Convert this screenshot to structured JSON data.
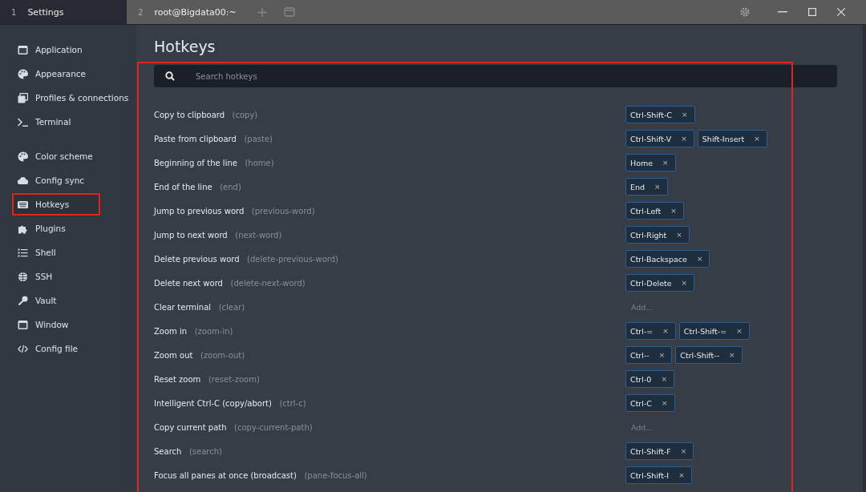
{
  "tabs": [
    {
      "number": "1",
      "label": "Settings",
      "selected": true
    },
    {
      "number": "2",
      "label": "root@Bigdata00:~",
      "selected": false
    }
  ],
  "new_tab": "+",
  "sidebar": {
    "sections": [
      [
        {
          "label": "Application",
          "selected": false
        },
        {
          "label": "Appearance",
          "selected": false
        },
        {
          "label": "Profiles & connections",
          "selected": false
        },
        {
          "label": "Terminal",
          "selected": false
        }
      ],
      [
        {
          "label": "Color scheme",
          "selected": false
        },
        {
          "label": "Config sync",
          "selected": false
        },
        {
          "label": "Hotkeys",
          "selected": true
        },
        {
          "label": "Plugins",
          "selected": false
        },
        {
          "label": "Shell",
          "selected": false
        },
        {
          "label": "SSH",
          "selected": false
        },
        {
          "label": "Vault",
          "selected": false
        },
        {
          "label": "Window",
          "selected": false
        },
        {
          "label": "Config file",
          "selected": false
        }
      ]
    ]
  },
  "page_title": "Hotkeys",
  "search": {
    "placeholder": "Search hotkeys"
  },
  "hotkeys": [
    {
      "label": "Copy to clipboard",
      "id": "(copy)",
      "keys": [
        "Ctrl-Shift-C"
      ]
    },
    {
      "label": "Paste from clipboard",
      "id": "(paste)",
      "keys": [
        "Ctrl-Shift-V",
        "Shift-Insert"
      ]
    },
    {
      "label": "Beginning of the line",
      "id": "(home)",
      "keys": [
        "Home"
      ]
    },
    {
      "label": "End of the line",
      "id": "(end)",
      "keys": [
        "End"
      ]
    },
    {
      "label": "Jump to previous word",
      "id": "(previous-word)",
      "keys": [
        "Ctrl-Left"
      ]
    },
    {
      "label": "Jump to next word",
      "id": "(next-word)",
      "keys": [
        "Ctrl-Right"
      ]
    },
    {
      "label": "Delete previous word",
      "id": "(delete-previous-word)",
      "keys": [
        "Ctrl-Backspace"
      ]
    },
    {
      "label": "Delete next word",
      "id": "(delete-next-word)",
      "keys": [
        "Ctrl-Delete"
      ]
    },
    {
      "label": "Clear terminal",
      "id": "(clear)",
      "add_label": "Add..."
    },
    {
      "label": "Zoom in",
      "id": "(zoom-in)",
      "keys": [
        "Ctrl-=",
        "Ctrl-Shift-="
      ]
    },
    {
      "label": "Zoom out",
      "id": "(zoom-out)",
      "keys": [
        "Ctrl--",
        "Ctrl-Shift--"
      ]
    },
    {
      "label": "Reset zoom",
      "id": "(reset-zoom)",
      "keys": [
        "Ctrl-0"
      ]
    },
    {
      "label": "Intelligent Ctrl-C (copy/abort)",
      "id": "(ctrl-c)",
      "keys": [
        "Ctrl-C"
      ]
    },
    {
      "label": "Copy current path",
      "id": "(copy-current-path)",
      "add_label": "Add..."
    },
    {
      "label": "Search",
      "id": "(search)",
      "keys": [
        "Ctrl-Shift-F"
      ]
    },
    {
      "label": "Focus all panes at once (broadcast)",
      "id": "(pane-focus-all)",
      "keys": [
        "Ctrl-Shift-I"
      ]
    }
  ],
  "remove_key": "×"
}
